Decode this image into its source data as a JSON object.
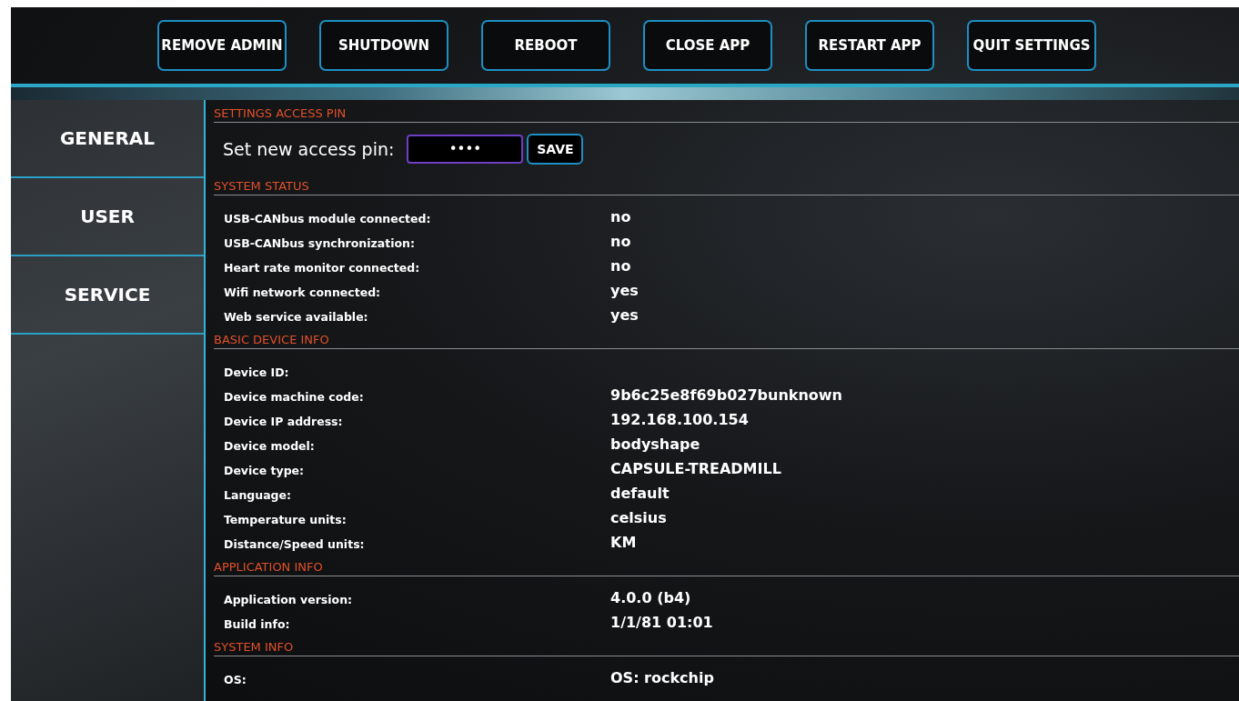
{
  "toolbar": {
    "buttons": [
      "REMOVE ADMIN",
      "SHUTDOWN",
      "REBOOT",
      "CLOSE APP",
      "RESTART APP",
      "QUIT SETTINGS"
    ]
  },
  "sidebar": {
    "items": [
      "GENERAL",
      "USER",
      "SERVICE"
    ]
  },
  "sections": [
    {
      "kind": "pin",
      "title": "SETTINGS ACCESS PIN",
      "label": "Set new access pin:",
      "value": "••••",
      "button": "SAVE"
    },
    {
      "kind": "rows",
      "title": "SYSTEM STATUS",
      "rows": [
        {
          "label": "USB-CANbus module connected:",
          "value": "no"
        },
        {
          "label": "USB-CANbus synchronization:",
          "value": "no"
        },
        {
          "label": "Heart rate monitor connected:",
          "value": "no"
        },
        {
          "label": "Wifi network connected:",
          "value": "yes"
        },
        {
          "label": "Web service available:",
          "value": "yes"
        }
      ]
    },
    {
      "kind": "rows",
      "title": "BASIC DEVICE INFO",
      "rows": [
        {
          "label": "Device ID:"
        },
        {
          "label": "Device machine code:",
          "value": "9b6c25e8f69b027bunknown"
        },
        {
          "label": "Device IP address:",
          "value": "192.168.100.154"
        },
        {
          "label": "Device model:",
          "value": "bodyshape"
        },
        {
          "label": "Device type:",
          "value": "CAPSULE-TREADMILL"
        },
        {
          "label": "Language:",
          "value": "default"
        },
        {
          "label": "Temperature units:",
          "value": "celsius"
        },
        {
          "label": "Distance/Speed units:",
          "value": "KM"
        }
      ]
    },
    {
      "kind": "rows",
      "title": "APPLICATION INFO",
      "rows": [
        {
          "label": "Application version:",
          "value": "4.0.0 (b4)"
        },
        {
          "label": "Build info:",
          "value": "1/1/81 01:01"
        }
      ]
    },
    {
      "kind": "rows",
      "title": "SYSTEM INFO",
      "rows": [
        {
          "label": "OS:",
          "value": "OS: rockchip"
        }
      ]
    }
  ]
}
